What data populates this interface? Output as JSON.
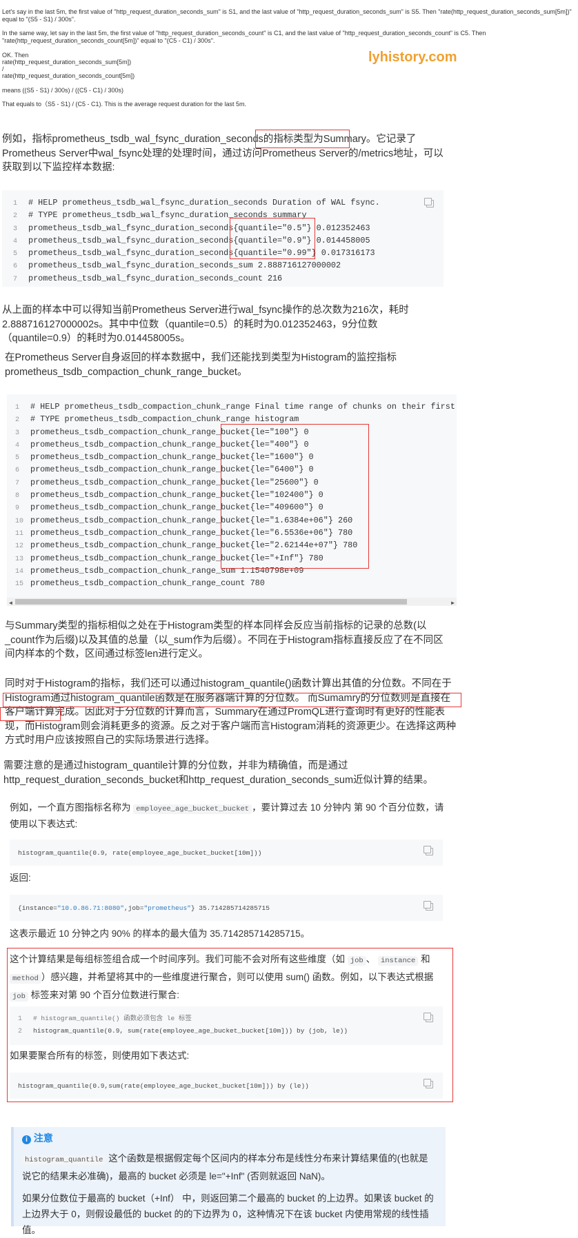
{
  "intro": {
    "p1": "Let's say in the last 5m, the first value of \"http_request_duration_seconds_sum\" is S1, and the last value of \"http_request_duration_seconds_sum\" is S5. Then \"rate(http_request_duration_seconds_sum[5m])\" equal to \"(S5 - S1) / 300s\".",
    "p2": "In the same way, let say in the last 5m, the first value of \"http_request_duration_seconds_count\" is C1, and the last value of \"http_request_duration_seconds_count\" is C5. Then \"rate(http_request_duration_seconds_count[5m])\" equal to \"(C5 - C1) / 300s\".",
    "ok": "OK. Then",
    "l1": " rate(http_request_duration_seconds_sum[5m])",
    "l2": "/",
    "l3": " rate(http_request_duration_seconds_count[5m])",
    "means": "means ((S5 - S1) / 300s) / ((C5 - C1) / 300s)",
    "equals": "That equals to（S5 - S1) / (C5 - C1). This is the average request duration for the last 5m."
  },
  "watermark": "lyhistory.com",
  "summary_para": {
    "a": "例如，指标prometheus_tsdb_wal_fsync_duration_seconds的",
    "b": "指标类型为Summary。",
    "c": "它记录了Prometheus Server中wal_fsync处理的处理时间，通过访问Prometheus Server的/metrics地址，可以获取到以下监控样本数据:"
  },
  "code1": [
    {
      "n": "1",
      "t": "# HELP prometheus_tsdb_wal_fsync_duration_seconds Duration of WAL fsync."
    },
    {
      "n": "2",
      "t": "# TYPE prometheus_tsdb_wal_fsync_duration_seconds summary"
    },
    {
      "n": "3",
      "t": "prometheus_tsdb_wal_fsync_duration_seconds{quantile=\"0.5\"} 0.012352463"
    },
    {
      "n": "4",
      "t": "prometheus_tsdb_wal_fsync_duration_seconds{quantile=\"0.9\"} 0.014458005"
    },
    {
      "n": "5",
      "t": "prometheus_tsdb_wal_fsync_duration_seconds{quantile=\"0.99\"} 0.017316173"
    },
    {
      "n": "6",
      "t": "prometheus_tsdb_wal_fsync_duration_seconds_sum 2.888716127000002"
    },
    {
      "n": "7",
      "t": "prometheus_tsdb_wal_fsync_duration_seconds_count 216"
    }
  ],
  "para_after_summary": "从上面的样本中可以得知当前Prometheus Server进行wal_fsync操作的总次数为216次，耗时2.888716127000002s。其中中位数（quantile=0.5）的耗时为0.012352463，9分位数（quantile=0.9）的耗时为0.014458005s。",
  "para_hist_intro": "在Prometheus Server自身返回的样本数据中，我们还能找到类型为Histogram的监控指标prometheus_tsdb_compaction_chunk_range_bucket。",
  "code2": [
    {
      "n": "1",
      "t": "# HELP prometheus_tsdb_compaction_chunk_range Final time range of chunks on their first"
    },
    {
      "n": "2",
      "t": "# TYPE prometheus_tsdb_compaction_chunk_range histogram"
    },
    {
      "n": "3",
      "t": "prometheus_tsdb_compaction_chunk_range_bucket{le=\"100\"} 0"
    },
    {
      "n": "4",
      "t": "prometheus_tsdb_compaction_chunk_range_bucket{le=\"400\"} 0"
    },
    {
      "n": "5",
      "t": "prometheus_tsdb_compaction_chunk_range_bucket{le=\"1600\"} 0"
    },
    {
      "n": "6",
      "t": "prometheus_tsdb_compaction_chunk_range_bucket{le=\"6400\"} 0"
    },
    {
      "n": "7",
      "t": "prometheus_tsdb_compaction_chunk_range_bucket{le=\"25600\"} 0"
    },
    {
      "n": "8",
      "t": "prometheus_tsdb_compaction_chunk_range_bucket{le=\"102400\"} 0"
    },
    {
      "n": "9",
      "t": "prometheus_tsdb_compaction_chunk_range_bucket{le=\"409600\"} 0"
    },
    {
      "n": "10",
      "t": "prometheus_tsdb_compaction_chunk_range_bucket{le=\"1.6384e+06\"} 260"
    },
    {
      "n": "11",
      "t": "prometheus_tsdb_compaction_chunk_range_bucket{le=\"6.5536e+06\"} 780"
    },
    {
      "n": "12",
      "t": "prometheus_tsdb_compaction_chunk_range_bucket{le=\"2.62144e+07\"} 780"
    },
    {
      "n": "13",
      "t": "prometheus_tsdb_compaction_chunk_range_bucket{le=\"+Inf\"} 780"
    },
    {
      "n": "14",
      "t": "prometheus_tsdb_compaction_chunk_range_sum 1.1540798e+09"
    },
    {
      "n": "15",
      "t": "prometheus_tsdb_compaction_chunk_range_count 780"
    }
  ],
  "para_similar": "与Summary类型的指标相似之处在于Histogram类型的样本同样会反应当前指标的记录的总数(以_count作为后缀)以及其值的总量（以_sum作为后缀）。不同在于Histogram指标直接反应了在不同区间内样本的个数，区间通过标签len进行定义。",
  "para_quantile": {
    "a": "同时对于Histogram的指标，我们还可以通过histogram_quantile()函数计算出其值的分位数。不同在于",
    "b": "Histogram通过histogram_quantile函数是在服务器端计算的分位数。 而Sumamry的分位数则是直接在客户",
    "c": "端计算完成。",
    "d": "因此对于分位数的计算而言，Summary在通过PromQL进行查询时有更好的性能表现，而Histogram则会消耗更多的资源。反之对于客户端而言Histogram消耗的资源更少。在选择这两种方式时用户应该按照自己的实际场景进行选择。"
  },
  "para_note_precise": "需要注意的是通过histogram_quantile计算的分位数，并非为精确值，而是通过http_request_duration_seconds_bucket和http_request_duration_seconds_sum近似计算的结果。",
  "example": {
    "p1a": "例如，一个直方图指标名称为",
    "p1_code": "employee_age_bucket_bucket",
    "p1b": "，要计算过去 10 分钟内 第 90 个百分位数，请使用以下表达式:",
    "code_a": "histogram_quantile(0.9, rate(employee_age_bucket_bucket[10m]))",
    "return_label": "返回:",
    "ret_open": "{instance=",
    "ret_v1": "\"10.0.86.71:8080\"",
    "ret_mid": ",job=",
    "ret_v2": "\"prometheus\"",
    "ret_close": "} 35.714285714285715",
    "meaning": "这表示最近 10 分钟之内 90% 的样本的最大值为 35.714285714285715。",
    "agg_a": "这个计算结果是每组标签组合成一个时间序列。我们可能不会对所有这些维度（如",
    "agg_c1": "job",
    "agg_sep1": "、",
    "agg_c2": "instance",
    "agg_and": "和",
    "agg_c3": "method",
    "agg_b": "）感兴趣，并希望将其中的一些维度进行聚合，则可以使用 sum() 函数。例如，以下表达式根据",
    "agg_c4": "job",
    "agg_d": "标签来对第 90 个百分位数进行聚合:",
    "code_b1": "# histogram_quantile() 函数必须包含 le 标签",
    "code_b2": "histogram_quantile(0.9, sum(rate(employee_age_bucket_bucket[10m])) by (job, le))",
    "all_labels": "如果要聚合所有的标签，则使用如下表达式:",
    "code_c": "histogram_quantile(0.9,sum(rate(employee_age_bucket_bucket[10m])) by (le))"
  },
  "note": {
    "title": "注意",
    "p1_code": "histogram_quantile",
    "p1": "这个函数是根据假定每个区间内的样本分布是线性分布来计算结果值的(也就是说它的结果未必准确)，最高的 bucket 必须是 le=\"+Inf\" (否则就返回 NaN)。",
    "p2": "如果分位数位于最高的 bucket（+Inf） 中，则返回第二个最高的 bucket 的上边界。如果该 bucket 的上边界大于 0，则假设最低的 bucket 的的下边界为 0，这种情况下在该 bucket 内使用常规的线性插值。"
  },
  "colors": {
    "highlight_box": "#e53935",
    "watermark": "#f0a030",
    "note_title": "#1e88e5"
  }
}
